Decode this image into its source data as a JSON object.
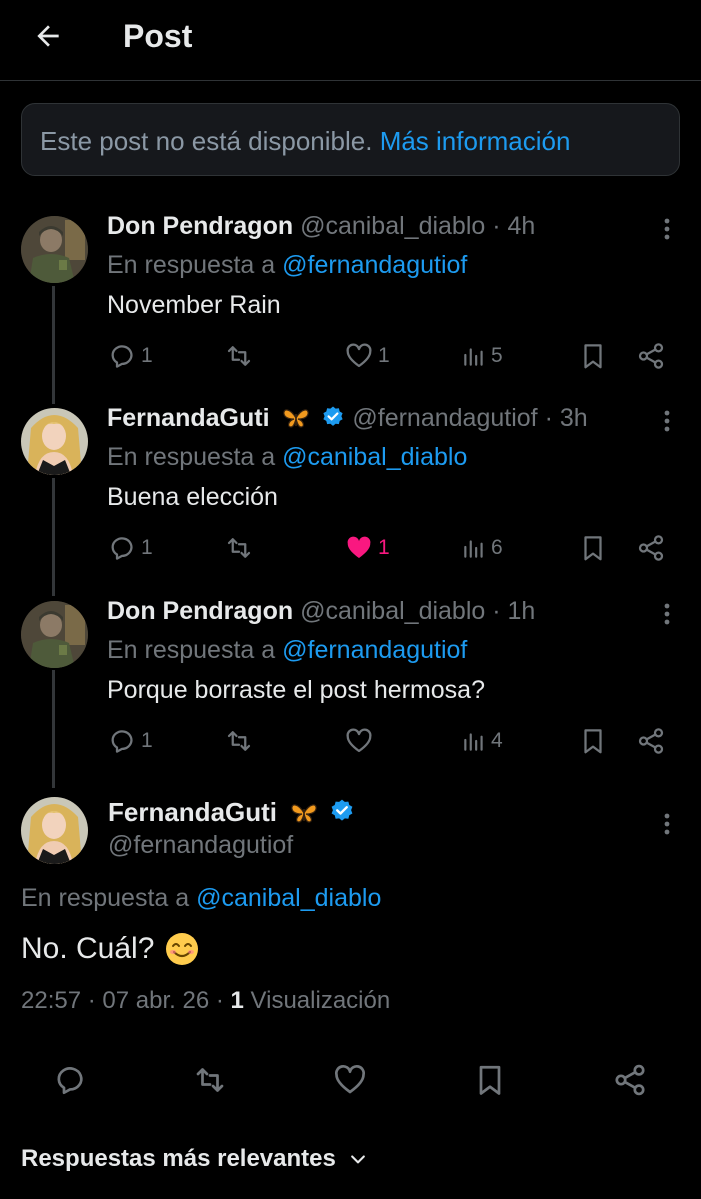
{
  "header": {
    "title": "Post"
  },
  "notice": {
    "text": "Este post no está disponible.",
    "link": "Más información"
  },
  "replies": [
    {
      "name": "Don Pendragon",
      "handle": "@canibal_diablo",
      "time": "4h",
      "replying_prefix": "En respuesta a",
      "replying_to": "@fernandagutiof",
      "text": "November Rain",
      "replies": "1",
      "reposts": "",
      "likes": "1",
      "views": "5",
      "liked": false
    },
    {
      "name": "FernandaGuti",
      "emoji": "butterfly",
      "verified": true,
      "handle": "@fernandagutiof",
      "time": "3h",
      "replying_prefix": "En respuesta a",
      "replying_to": "@canibal_diablo",
      "text": "Buena elección",
      "replies": "1",
      "reposts": "",
      "likes": "1",
      "views": "6",
      "liked": true
    },
    {
      "name": "Don Pendragon",
      "handle": "@canibal_diablo",
      "time": "1h",
      "replying_prefix": "En respuesta a",
      "replying_to": "@fernandagutiof",
      "text": "Porque borraste el post hermosa?",
      "replies": "1",
      "reposts": "",
      "likes": "",
      "views": "4",
      "liked": false
    }
  ],
  "main": {
    "name": "FernandaGuti",
    "emoji": "butterfly",
    "verified": true,
    "handle": "@fernandagutiof",
    "replying_prefix": "En respuesta a",
    "replying_to": "@canibal_diablo",
    "text": "No. Cuál?",
    "text_emoji": "smiling-face",
    "time": "22:57",
    "date": "07 abr. 26",
    "views_count": "1",
    "views_label": "Visualización"
  },
  "sort": {
    "label": "Respuestas más relevantes"
  },
  "colors": {
    "accent": "#1d9bf0",
    "like": "#f91880",
    "muted": "#71767b",
    "verified": "#1d9bf0"
  }
}
